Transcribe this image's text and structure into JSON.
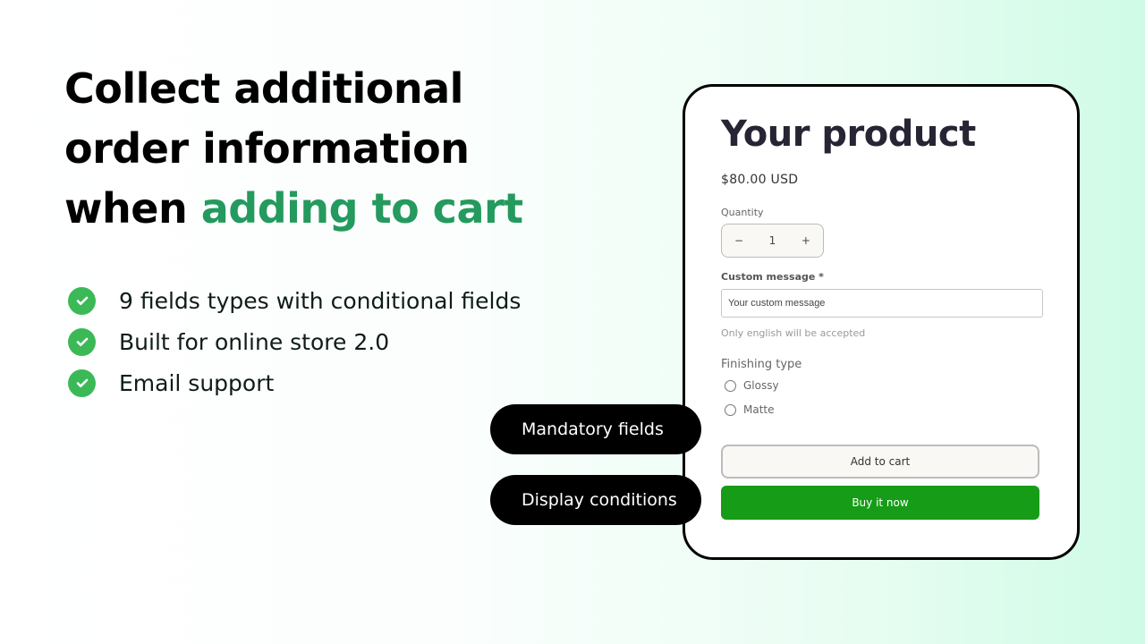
{
  "headline": {
    "line1": "Collect additional",
    "line2": "order information",
    "line3_prefix": "when ",
    "line3_accent": "adding to cart"
  },
  "colors": {
    "accent": "#249a5e",
    "check": "#3cb957",
    "buy_button": "#169c17"
  },
  "features": [
    {
      "icon": "check-circle-icon",
      "text": "9 fields types with conditional fields"
    },
    {
      "icon": "check-circle-icon",
      "text": "Built for online store 2.0"
    },
    {
      "icon": "check-circle-icon",
      "text": "Email support"
    }
  ],
  "product": {
    "title": "Your product",
    "price": "$80.00 USD",
    "quantity_label": "Quantity",
    "quantity_value": "1",
    "minus": "−",
    "plus": "+",
    "custom_message_label": "Custom message *",
    "custom_message_placeholder": "Your custom message",
    "hint": "Only english will be accepted",
    "finishing_label": "Finishing type",
    "finishing_options": [
      "Glossy",
      "Matte"
    ],
    "add_to_cart": "Add to cart",
    "buy_now": "Buy it now"
  },
  "pills": [
    "Mandatory fields",
    "Display conditions"
  ]
}
